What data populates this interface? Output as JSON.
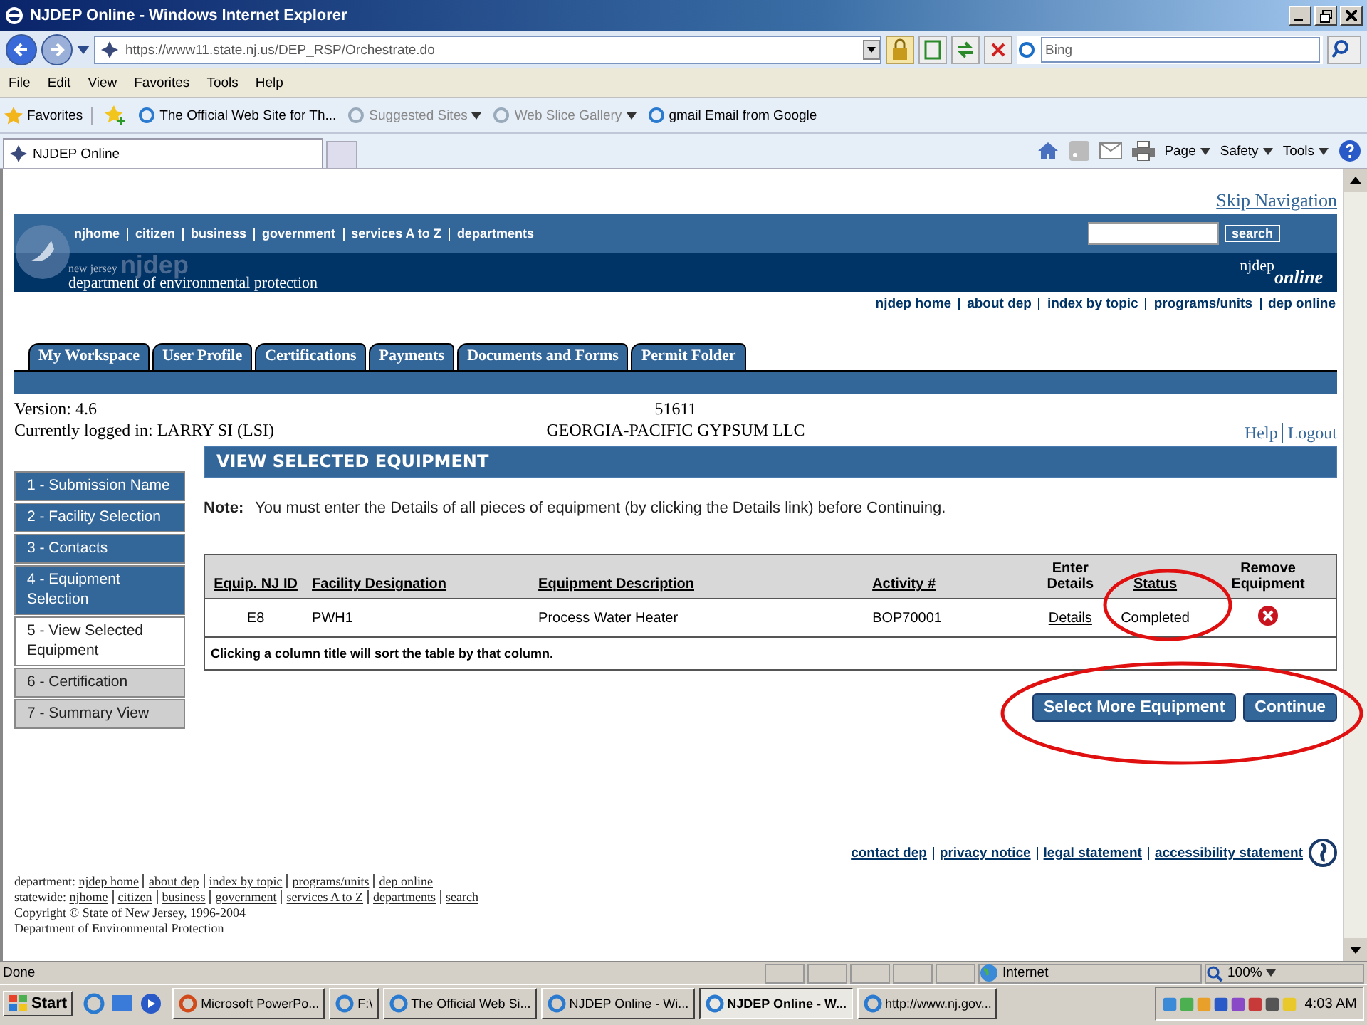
{
  "window": {
    "title": "NJDEP Online - Windows Internet Explorer"
  },
  "address_bar": {
    "url": "https://www11.state.nj.us/DEP_RSP/Orchestrate.do",
    "search_placeholder": "Bing"
  },
  "menu": [
    "File",
    "Edit",
    "View",
    "Favorites",
    "Tools",
    "Help"
  ],
  "favorites_bar": {
    "label": "Favorites",
    "items": [
      {
        "label": "The Official Web Site for Th...",
        "dropdown": false,
        "disabled": false
      },
      {
        "label": "Suggested Sites",
        "dropdown": true,
        "disabled": true
      },
      {
        "label": "Web Slice Gallery",
        "dropdown": true,
        "disabled": true
      },
      {
        "label": "gmail Email from Google",
        "dropdown": false,
        "disabled": false
      }
    ]
  },
  "browser_tab": {
    "label": "NJDEP Online"
  },
  "command_bar": [
    "Page",
    "Safety",
    "Tools"
  ],
  "page": {
    "skip_link": "Skip Navigation",
    "top_links": [
      "njhome",
      "citizen",
      "business",
      "government",
      "services A to Z",
      "departments"
    ],
    "search_button": "search",
    "agency": {
      "state": "new jersey",
      "short": "njdep",
      "name": "department of environmental protection"
    },
    "brand": {
      "name": "njdep",
      "suffix": "online"
    },
    "site_links": [
      "njdep home",
      "about dep",
      "index by topic",
      "programs/units",
      "dep online"
    ],
    "tabs": [
      "My Workspace",
      "User Profile",
      "Certifications",
      "Payments",
      "Documents and Forms",
      "Permit Folder"
    ],
    "version": "Version: 4.6",
    "logged_in": "Currently logged in: LARRY SI (LSI)",
    "facility_id": "51611",
    "facility_name": "GEORGIA-PACIFIC GYPSUM LLC",
    "help": "Help",
    "logout": "Logout",
    "steps": [
      {
        "label": "1 - Submission Name",
        "selected": false,
        "completed": true
      },
      {
        "label": "2 - Facility Selection",
        "selected": false,
        "completed": true
      },
      {
        "label": "3 - Contacts",
        "selected": false,
        "completed": true
      },
      {
        "label": "4 - Equipment Selection",
        "selected": false,
        "completed": true
      },
      {
        "label": "5 - View Selected Equipment",
        "selected": true,
        "completed": false
      },
      {
        "label": "6 - Certification",
        "selected": false,
        "completed": false
      },
      {
        "label": "7 - Summary View",
        "selected": false,
        "completed": false
      }
    ],
    "section_title": "VIEW SELECTED EQUIPMENT",
    "note_label": "Note:",
    "note": "You must enter the Details of all pieces of equipment (by clicking the Details link) before Continuing.",
    "table": {
      "columns": [
        {
          "label": "Equip. NJ ID",
          "sortable": true
        },
        {
          "label": "Facility Designation",
          "sortable": true
        },
        {
          "label": "Equipment Description",
          "sortable": true
        },
        {
          "label": "Activity #",
          "sortable": true
        },
        {
          "label": "Enter Details",
          "sortable": false
        },
        {
          "label": "Status",
          "sortable": true
        },
        {
          "label": "Remove Equipment",
          "sortable": false
        }
      ],
      "rows": [
        {
          "id": "E8",
          "facility": "PWH1",
          "description": "Process Water Heater",
          "activity": "BOP70001",
          "details": "Details",
          "status": "Completed"
        }
      ],
      "footer": "Clicking a column title will sort the table by that column."
    },
    "buttons": [
      "Select More Equipment",
      "Continue"
    ],
    "footer_links": [
      "contact dep",
      "privacy notice",
      "legal statement",
      "accessibility statement"
    ],
    "department_label": "department:",
    "department_links": [
      "njdep home",
      "about dep",
      "index by topic",
      "programs/units",
      "dep online"
    ],
    "statewide_label": "statewide:",
    "statewide_links": [
      "njhome",
      "citizen",
      "business",
      "government",
      "services A to Z",
      "departments",
      "search"
    ],
    "copyright": "Copyright © State of New Jersey, 1996-2004",
    "department_name": "Department of Environmental Protection"
  },
  "status_bar": {
    "text": "Done",
    "zone": "Internet",
    "zoom": "100%"
  },
  "taskbar": {
    "start": "Start",
    "items": [
      {
        "label": "Microsoft PowerPo...",
        "selected": false
      },
      {
        "label": "F:\\",
        "selected": false
      },
      {
        "label": "The Official Web Si...",
        "selected": false
      },
      {
        "label": "NJDEP Online - Wi...",
        "selected": false
      },
      {
        "label": "NJDEP Online - W...",
        "selected": true
      },
      {
        "label": "http://www.nj.gov...",
        "selected": false
      }
    ],
    "clock": "4:03 AM"
  }
}
